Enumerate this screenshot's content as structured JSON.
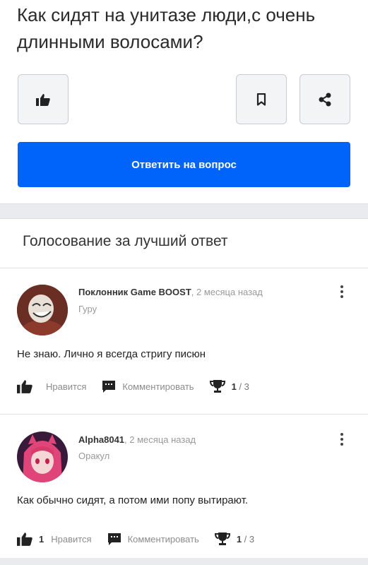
{
  "question": {
    "title": "Как сидят на унитазе люди,с очень длинными волосами?",
    "answer_button": "Ответить на вопрос"
  },
  "icons": {
    "like": "thumbs-up-icon",
    "bookmark": "bookmark-icon",
    "share": "share-icon",
    "comment": "comment-icon",
    "trophy": "trophy-icon",
    "menu": "kebab-menu-icon"
  },
  "colors": {
    "accent": "#0064fa",
    "background": "#e9ebee"
  },
  "voting": {
    "title": "Голосование за лучший ответ",
    "answers": [
      {
        "author": "Поклонник Game BOOST",
        "time": ", 2 месяца назад",
        "rank": "Гуру",
        "text": "Не знаю. Лично я всегда стригу писюн",
        "like_count": "",
        "like_label": "Нравится",
        "comment_label": "Комментировать",
        "score_current": "1",
        "score_total": " / 3"
      },
      {
        "author": "Alpha8041",
        "time": ", 2 месяца назад",
        "rank": "Оракул",
        "text": "Как обычно сидят, а потом ими попу вытирают.",
        "like_count": "1",
        "like_label": "Нравится",
        "comment_label": "Комментировать",
        "score_current": "1",
        "score_total": " / 3"
      }
    ]
  }
}
